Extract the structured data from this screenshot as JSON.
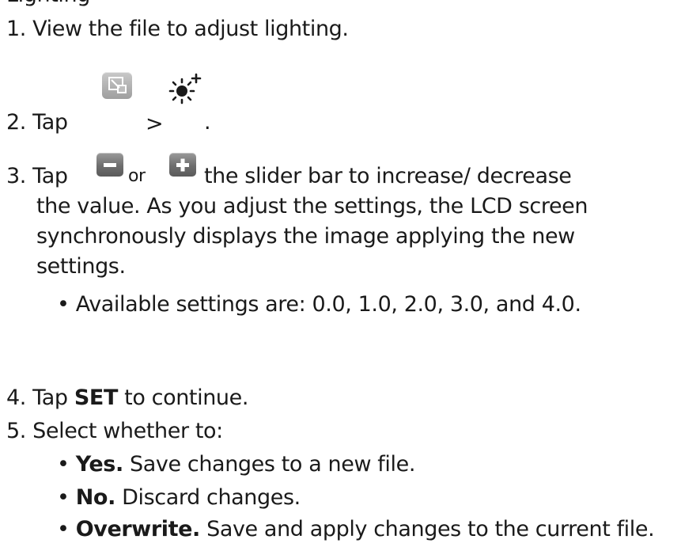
{
  "cut_top_text": "Lighting",
  "steps": [
    {
      "num": "1.",
      "text": "View the file to adjust lighting."
    },
    {
      "num": "2.",
      "pre": "Tap",
      "sep": ">",
      "post": "."
    },
    {
      "num": "3.",
      "pre": "Tap",
      "or": "or",
      "line1_rest": "the slider bar to increase/ decrease",
      "line2": "the value. As you adjust the settings, the LCD screen",
      "line3": "synchronously displays the image applying the new",
      "line4": "settings.",
      "bullet": "Available settings are: 0.0, 1.0, 2.0, 3.0, and 4.0."
    },
    {
      "num": "4.",
      "pre": "Tap",
      "bold": "SET",
      "post": "to continue."
    },
    {
      "num": "5.",
      "text": "Select whether to:"
    }
  ],
  "options": [
    {
      "bold": "Yes.",
      "text": "Save changes to a new file."
    },
    {
      "bold": "No.",
      "text": "Discard changes."
    },
    {
      "bold": "Overwrite.",
      "text": "Save and apply changes to the current file."
    }
  ],
  "icons": [
    "crop-edit-icon",
    "brightness-plus-icon",
    "minus-button-icon",
    "plus-button-icon"
  ],
  "colors": {
    "text": "#1a1a1a",
    "button": "#777777"
  }
}
